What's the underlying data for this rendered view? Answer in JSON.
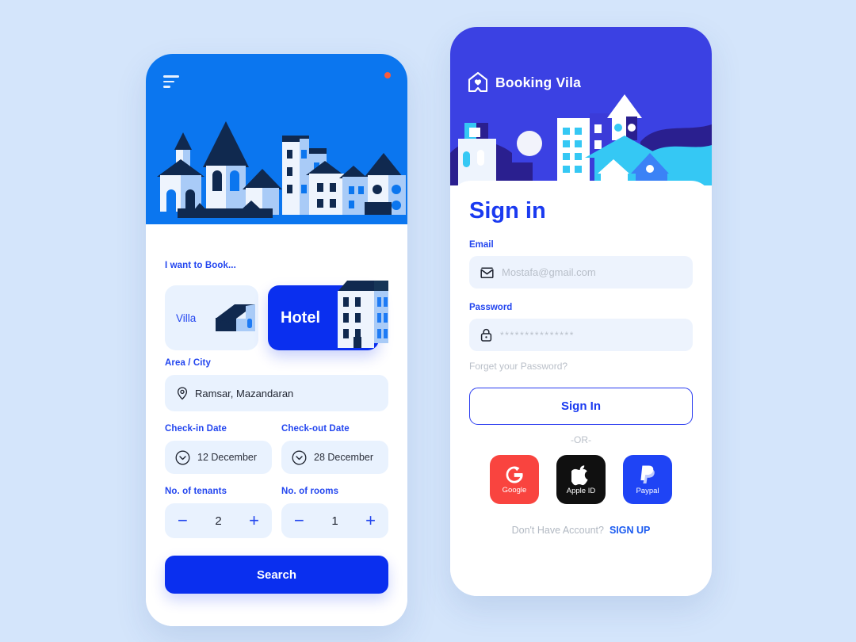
{
  "theme": {
    "page_bg": "#d4e5fb",
    "left_hero_blue": "#0b76ef",
    "right_hero_blue": "#3b41e3",
    "accent_blue": "#0a2fef",
    "label_blue": "#2346ef",
    "light_field": "#e9f2fe",
    "notification_dot": "#fc5b3a"
  },
  "booking_screen": {
    "menu_icon": "hamburger-icon",
    "notification_icon": "bell-icon",
    "has_notification": true,
    "section_title": "I want to Book...",
    "types": [
      {
        "label": "Villa",
        "icon": "house-icon",
        "selected": false
      },
      {
        "label": "Hotel",
        "icon": "building-icon",
        "selected": true
      }
    ],
    "area_label": "Area / City",
    "area_icon": "location-pin-icon",
    "area_value": "Ramsar, Mazandaran",
    "checkin_label": "Check-in Date",
    "checkin_icon": "chevron-down-circle-icon",
    "checkin_value": "12 December",
    "checkout_label": "Check-out Date",
    "checkout_icon": "chevron-down-circle-icon",
    "checkout_value": "28 December",
    "tenants_label": "No. of tenants",
    "tenants_value": "2",
    "rooms_label": "No. of rooms",
    "rooms_value": "1",
    "minus_icon": "minus-icon",
    "plus_icon": "plus-icon",
    "search_button": "Search"
  },
  "signin_screen": {
    "brand_name": "Booking Vila",
    "brand_icon": "house-heart-logo-icon",
    "title": "Sign in",
    "email_label": "Email",
    "email_icon": "envelope-icon",
    "email_placeholder": "Mostafa@gmail.com",
    "password_label": "Password",
    "password_icon": "lock-icon",
    "password_value": "***************",
    "forgot_link": "Forget your Password?",
    "signin_button": "Sign In",
    "or_divider": "-OR-",
    "social": [
      {
        "label": "Google",
        "icon": "google-icon",
        "color": "#f9443f"
      },
      {
        "label": "Apple ID",
        "icon": "apple-icon",
        "color": "#101010"
      },
      {
        "label": "Paypal",
        "icon": "paypal-icon",
        "color": "#1f44f5"
      }
    ],
    "footer_question": "Don't Have Account?",
    "footer_action": "SIGN UP"
  }
}
